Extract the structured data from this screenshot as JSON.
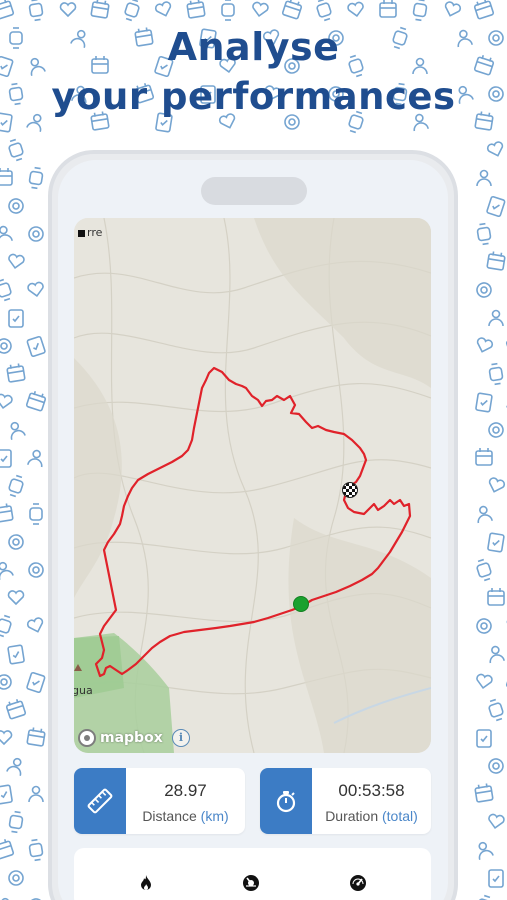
{
  "headline": {
    "line1": "Analyse",
    "line2": "your performances"
  },
  "map": {
    "place_top": "rre",
    "place_bottom": "gua",
    "attribution": "mapbox",
    "info_icon": "info-icon",
    "start_marker": "green-dot",
    "finish_marker": "checkered-flag-icon"
  },
  "stats": [
    {
      "icon": "ruler-icon",
      "value": "28.97",
      "label": "Distance",
      "unit": "(km)"
    },
    {
      "icon": "stopwatch-icon",
      "value": "00:53:58",
      "label": "Duration",
      "unit": "(total)"
    }
  ],
  "bottom_icons": [
    "flame-icon",
    "gauge-icon",
    "speedometer-icon"
  ],
  "colors": {
    "brand": "#1f4d8f",
    "accent": "#3c7cc5",
    "route": "#e0222a",
    "start": "#1aa12e"
  }
}
